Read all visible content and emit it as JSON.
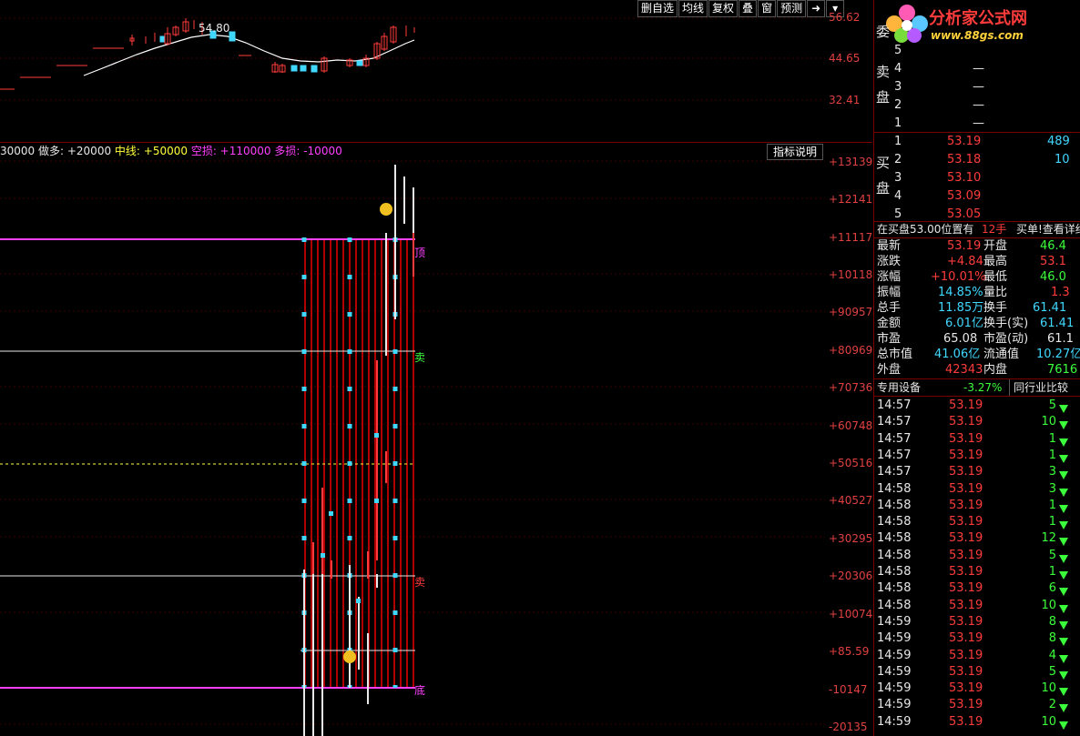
{
  "toolbar": {
    "buttons": [
      "删自选",
      "均线",
      "复权",
      "叠",
      "窗",
      "预测"
    ]
  },
  "kline": {
    "peak_label": "54.80",
    "axis": [
      "56.62",
      "44.65",
      "32.41"
    ]
  },
  "indicator": {
    "header_parts": [
      {
        "text": "30000",
        "color": "#e8e8e8"
      },
      {
        "text": " 做多: +20000",
        "color": "#e8e8e8"
      },
      {
        "text": " 中线: +50000",
        "color": "#ffff3c"
      },
      {
        "text": " 空损: +110000",
        "color": "#ff40ff"
      },
      {
        "text": " 多损: -10000",
        "color": "#ff40ff"
      }
    ],
    "explain_button": "指标说明",
    "axis": [
      "+131399",
      "+121410",
      "+111178",
      "+101189",
      "+90957",
      "+80969",
      "+70736",
      "+60748",
      "+50516",
      "+40527",
      "+30295",
      "+20306",
      "+10074",
      "+85.59",
      "-10147",
      "-20135"
    ],
    "marks": {
      "top": "顶",
      "sell1": "卖",
      "sell2": "卖",
      "bottom": "底"
    }
  },
  "right": {
    "logo_text": "分析家公式网",
    "logo_url": "www.88gs.com",
    "sell_label": [
      "委",
      "卖",
      "盘"
    ],
    "buy_label": [
      "买",
      "盘"
    ],
    "sell_orders": [
      {
        "level": "5",
        "price": "",
        "vol": ""
      },
      {
        "level": "4",
        "price": "—",
        "vol": ""
      },
      {
        "level": "3",
        "price": "—",
        "vol": ""
      },
      {
        "level": "2",
        "price": "—",
        "vol": ""
      },
      {
        "level": "1",
        "price": "—",
        "vol": ""
      }
    ],
    "buy_orders": [
      {
        "level": "1",
        "price": "53.19",
        "vol": "489"
      },
      {
        "level": "2",
        "price": "53.18",
        "vol": "10"
      },
      {
        "level": "3",
        "price": "53.10",
        "vol": ""
      },
      {
        "level": "4",
        "price": "53.09",
        "vol": ""
      },
      {
        "level": "5",
        "price": "53.05",
        "vol": ""
      }
    ],
    "notice_left": "在买盘53.00位置有",
    "notice_qty": "12手",
    "notice_right": "买单!查看详细",
    "quote": [
      {
        "l1": "最新",
        "v1": "53.19",
        "c1": "red",
        "l2": "开盘",
        "v2": "46.4",
        "c2": "green"
      },
      {
        "l1": "涨跌",
        "v1": "+4.84",
        "c1": "red",
        "l2": "最高",
        "v2": "53.1",
        "c2": "red"
      },
      {
        "l1": "涨幅",
        "v1": "+10.01%",
        "c1": "red",
        "l2": "最低",
        "v2": "46.0",
        "c2": "green"
      },
      {
        "l1": "振幅",
        "v1": "14.85%",
        "c1": "cyan",
        "l2": "量比",
        "v2": "1.3",
        "c2": "red"
      },
      {
        "l1": "总手",
        "v1": "11.85万",
        "c1": "cyan",
        "l2": "换手",
        "v2": "61.41",
        "c2": "cyan"
      },
      {
        "l1": "金额",
        "v1": "6.01亿",
        "c1": "cyan",
        "l2": "换手(实)",
        "v2": "61.41",
        "c2": "cyan"
      },
      {
        "l1": "市盈",
        "v1": "65.08",
        "c1": "white",
        "l2": "市盈(动)",
        "v2": "61.1",
        "c2": "white"
      },
      {
        "l1": "总市值",
        "v1": "41.06亿",
        "c1": "cyan",
        "l2": "流通值",
        "v2": "10.27亿",
        "c2": "cyan"
      },
      {
        "l1": "外盘",
        "v1": "42343",
        "c1": "red",
        "l2": "内盘",
        "v2": "7616",
        "c2": "green"
      }
    ],
    "sector_name": "专用设备",
    "sector_change": "-3.27%",
    "compare_button": "同行业比较",
    "ticks": [
      {
        "time": "14:57",
        "price": "53.19",
        "vol": "5"
      },
      {
        "time": "14:57",
        "price": "53.19",
        "vol": "10"
      },
      {
        "time": "14:57",
        "price": "53.19",
        "vol": "1"
      },
      {
        "time": "14:57",
        "price": "53.19",
        "vol": "1"
      },
      {
        "time": "14:57",
        "price": "53.19",
        "vol": "3"
      },
      {
        "time": "14:58",
        "price": "53.19",
        "vol": "3"
      },
      {
        "time": "14:58",
        "price": "53.19",
        "vol": "1"
      },
      {
        "time": "14:58",
        "price": "53.19",
        "vol": "1"
      },
      {
        "time": "14:58",
        "price": "53.19",
        "vol": "12"
      },
      {
        "time": "14:58",
        "price": "53.19",
        "vol": "5"
      },
      {
        "time": "14:58",
        "price": "53.19",
        "vol": "1"
      },
      {
        "time": "14:58",
        "price": "53.19",
        "vol": "6"
      },
      {
        "time": "14:58",
        "price": "53.19",
        "vol": "10"
      },
      {
        "time": "14:59",
        "price": "53.19",
        "vol": "8"
      },
      {
        "time": "14:59",
        "price": "53.19",
        "vol": "8"
      },
      {
        "time": "14:59",
        "price": "53.19",
        "vol": "4"
      },
      {
        "time": "14:59",
        "price": "53.19",
        "vol": "5"
      },
      {
        "time": "14:59",
        "price": "53.19",
        "vol": "10"
      },
      {
        "time": "14:59",
        "price": "53.19",
        "vol": "2"
      },
      {
        "time": "14:59",
        "price": "53.19",
        "vol": "10"
      }
    ]
  }
}
